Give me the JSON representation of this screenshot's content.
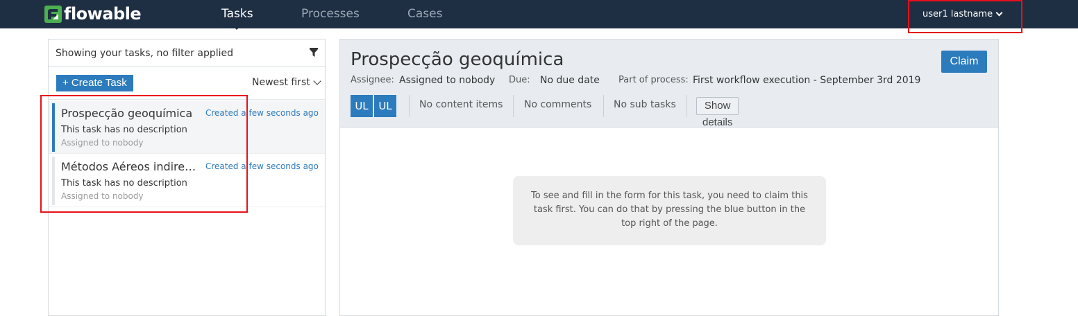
{
  "navbar": {
    "brand": "flowable",
    "tabs": [
      {
        "label": "Tasks",
        "active": true
      },
      {
        "label": "Processes",
        "active": false
      },
      {
        "label": "Cases",
        "active": false
      }
    ],
    "user_label": "user1 lastname",
    "colors": {
      "background": "#1f2f43",
      "brand_green": "#4caf50",
      "active": "#ffffff",
      "inactive": "#9aa7b5"
    }
  },
  "task_list": {
    "filter_text": "Showing your tasks, no filter applied",
    "filter_icon": "filter-icon",
    "create_button_label": "+ Create Task",
    "sort_label": "Newest first",
    "items": [
      {
        "title": "Prospecção geoquímica",
        "created": "Created a few seconds ago",
        "description": "This task has no description",
        "assignee": "Assigned to nobody",
        "selected": true
      },
      {
        "title": "Métodos Aéreos indiretos",
        "created": "Created a few seconds ago",
        "description": "This task has no description",
        "assignee": "Assigned to nobody",
        "selected": false
      }
    ]
  },
  "task_detail": {
    "title": "Prospecção geoquímica",
    "claim_label": "Claim",
    "assignee_label": "Assignee:",
    "assignee_value": "Assigned to nobody",
    "due_label": "Due:",
    "due_value": "No due date",
    "process_label": "Part of process:",
    "process_value": "First workflow execution - September 3rd 2019",
    "avatars": [
      "UL",
      "UL"
    ],
    "content_items": "No content items",
    "comments": "No comments",
    "sub_tasks": "No sub tasks",
    "show_details_label": "Show details",
    "notice": "To see and fill in the form for this task, you need to claim this task first. You can do that by pressing the blue button in the top right of the page."
  },
  "accent_color": "#2c7bbd",
  "highlight_color": "#e8101a"
}
